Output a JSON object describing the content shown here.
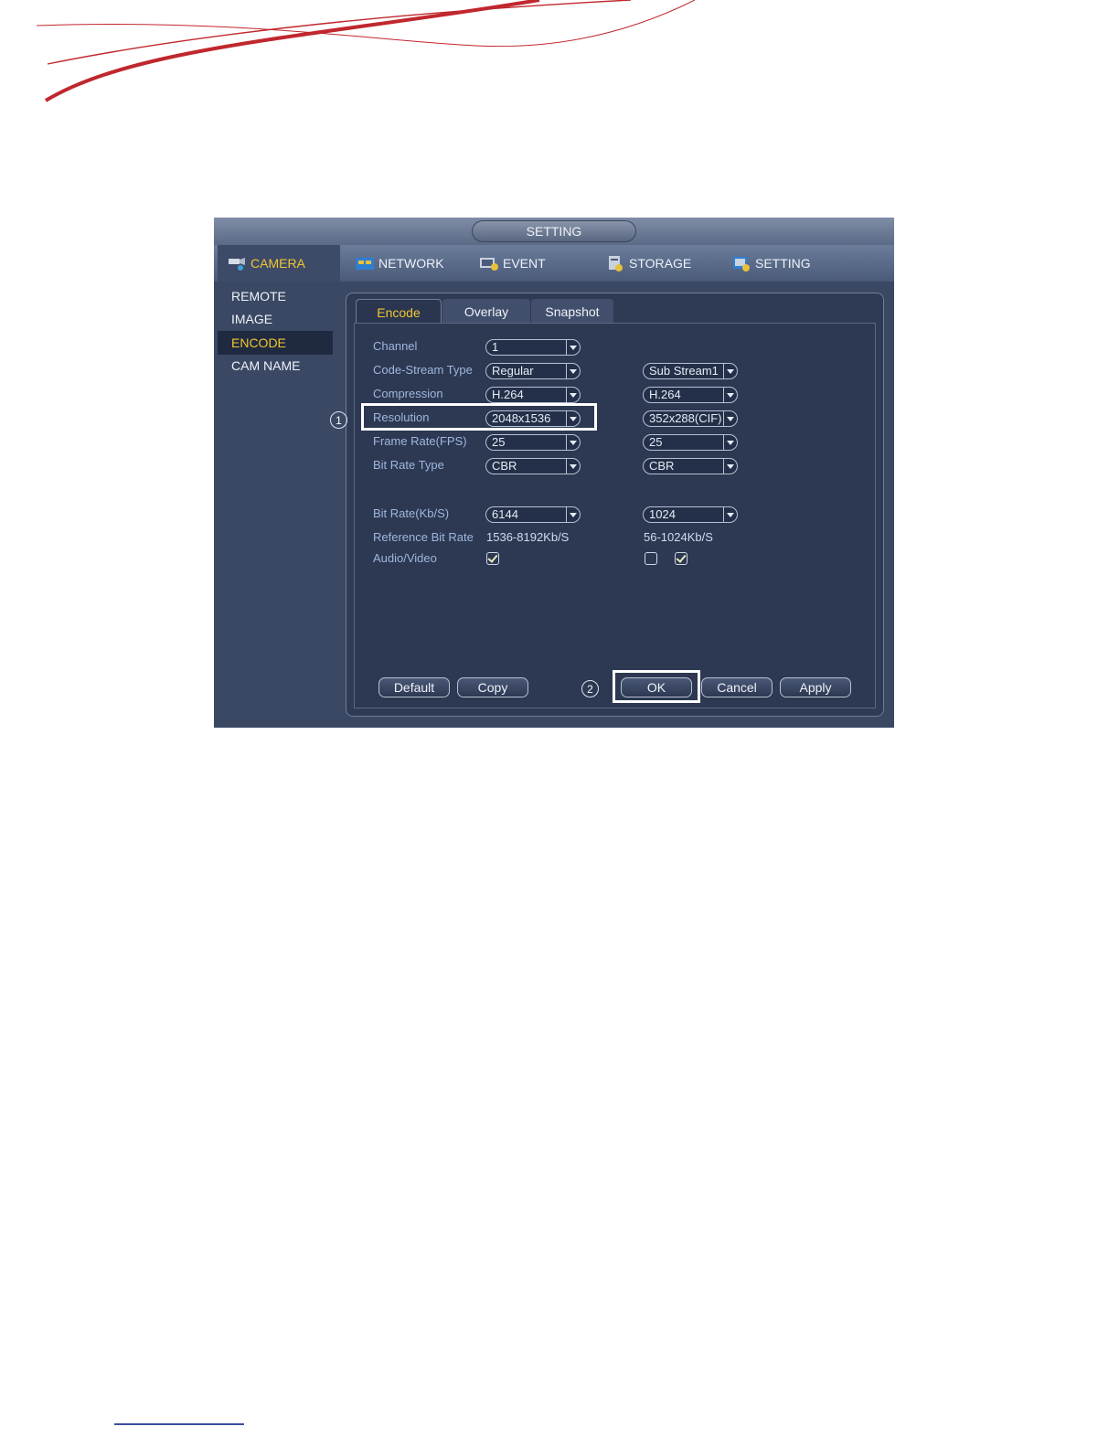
{
  "window": {
    "title": "SETTING"
  },
  "menu": {
    "camera": "CAMERA",
    "network": "NETWORK",
    "event": "EVENT",
    "storage": "STORAGE",
    "setting": "SETTING"
  },
  "sidebar": {
    "items": [
      {
        "label": "REMOTE"
      },
      {
        "label": "IMAGE"
      },
      {
        "label": "ENCODE"
      },
      {
        "label": "CAM NAME"
      }
    ]
  },
  "tabs": [
    {
      "label": "Encode"
    },
    {
      "label": "Overlay"
    },
    {
      "label": "Snapshot"
    }
  ],
  "form": {
    "channel": {
      "label": "Channel",
      "main": "1"
    },
    "code_stream_type": {
      "label": "Code-Stream Type",
      "main": "Regular",
      "sub": "Sub Stream1"
    },
    "compression": {
      "label": "Compression",
      "main": "H.264",
      "sub": "H.264"
    },
    "resolution": {
      "label": "Resolution",
      "main": "2048x1536",
      "sub": "352x288(CIF)"
    },
    "frame_rate": {
      "label": "Frame Rate(FPS)",
      "main": "25",
      "sub": "25"
    },
    "bit_rate_type": {
      "label": "Bit Rate Type",
      "main": "CBR",
      "sub": "CBR"
    },
    "bit_rate": {
      "label": "Bit Rate(Kb/S)",
      "main": "6144",
      "sub": "1024"
    },
    "reference_bit_rate": {
      "label": "Reference Bit Rate",
      "main": "1536-8192Kb/S",
      "sub": "56-1024Kb/S"
    },
    "audio_video": {
      "label": "Audio/Video"
    }
  },
  "buttons": {
    "default": "Default",
    "copy": "Copy",
    "ok": "OK",
    "cancel": "Cancel",
    "apply": "Apply"
  },
  "markers": {
    "one": "1",
    "two": "2"
  },
  "colors": {
    "accent": "#f2c531",
    "label": "#9fb7dd",
    "background": "#3a4864",
    "swoosh": "#c0272d"
  }
}
